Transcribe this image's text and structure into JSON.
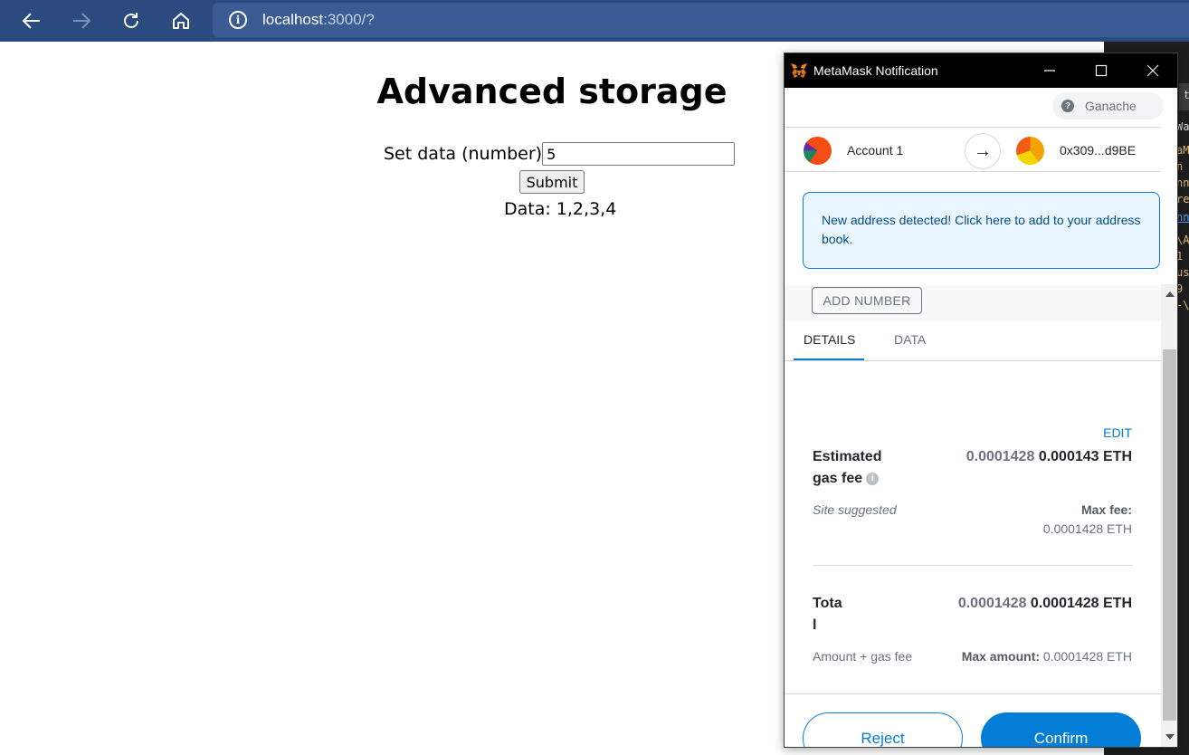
{
  "browser": {
    "url_host": "localhost",
    "url_rest": ":3000/?"
  },
  "page": {
    "title": "Advanced storage",
    "form_label": "Set data (number)",
    "input_value": "5",
    "submit_label": "Submit",
    "data_line": "Data: 1,2,3,4"
  },
  "terminal": {
    "tab_text": "t",
    "lines": [
      "Wa",
      "aM",
      "  n",
      "nn",
      "re",
      "nn",
      "\\A",
      "  1",
      "us",
      "  9",
      "-\\"
    ]
  },
  "metamask": {
    "window_title": "MetaMask Notification",
    "network": "Ganache",
    "from_account": "Account 1",
    "to_account": "0x309...d9BE",
    "alert_text": "New address detected! Click here to add to your address book.",
    "method_label": "ADD NUMBER",
    "tabs": [
      "DETAILS",
      "DATA"
    ],
    "edit_label": "EDIT",
    "gas": {
      "label_line1": "Estimated",
      "label_line2": "gas fee",
      "amount_secondary": "0.0001428",
      "amount_primary": "0.000143 ETH",
      "site_suggested": "Site suggested",
      "max_fee_label": "Max fee:",
      "max_fee_value": "0.0001428 ETH"
    },
    "total": {
      "label_line1": "Tota",
      "label_line2": "l",
      "amount_secondary": "0.0001428",
      "amount_primary": "0.0001428 ETH",
      "sub_label": "Amount + gas fee",
      "max_amount_label": "Max amount:",
      "max_amount_value": "0.0001428 ETH"
    },
    "reject_label": "Reject",
    "confirm_label": "Confirm"
  }
}
